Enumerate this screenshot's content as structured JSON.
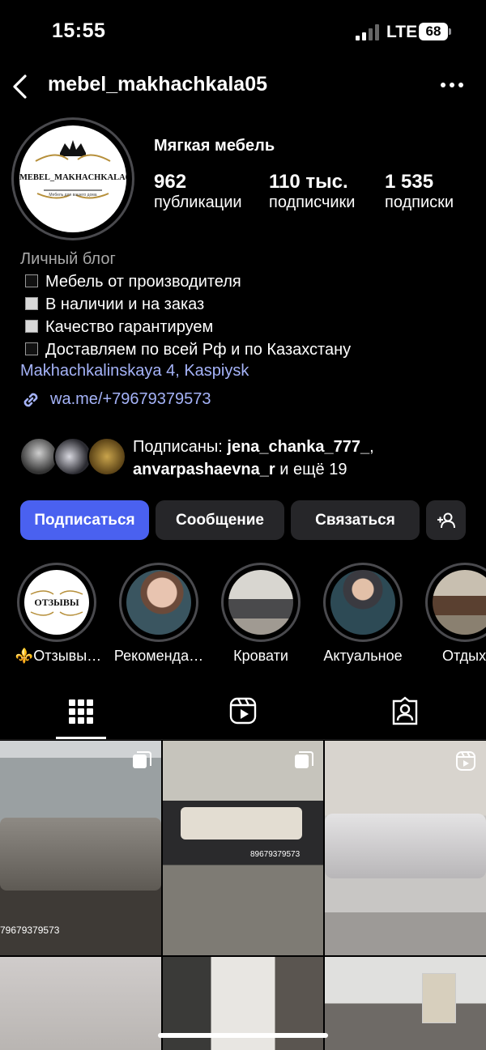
{
  "status_bar": {
    "time": "15:55",
    "network": "LTE",
    "battery": "68"
  },
  "header": {
    "username": "mebel_makhachkala05"
  },
  "profile": {
    "display_name": "Мягкая мебель",
    "avatar_text": "MEBEL_MAKHACHKALA05",
    "avatar_subtext": "Мебель для вашего дома",
    "stats": [
      {
        "value": "962",
        "label": "публикации"
      },
      {
        "value": "110 тыс.",
        "label": "подписчики"
      },
      {
        "value": "1 535",
        "label": "подписки"
      }
    ],
    "category": "Личный блог",
    "bio": [
      {
        "text": "Мебель от производителя",
        "marker": "dark"
      },
      {
        "text": "В наличии и на заказ",
        "marker": "light"
      },
      {
        "text": "Качество гарантируем",
        "marker": "light"
      },
      {
        "text": "Доставляем по всей Рф и по Казахстану",
        "marker": "dark"
      }
    ],
    "location": "Makhachkalinskaya 4, Kaspiysk",
    "link": "wa.me/+79679379573",
    "followed_by": {
      "prefix": "Подписаны: ",
      "user1": "jena_chanka_777_",
      "sep": ",",
      "user2": "anvarpashaevna_r",
      "suffix": " и ещё 19"
    }
  },
  "actions": {
    "follow": "Подписаться",
    "message": "Сообщение",
    "contact": "Связаться"
  },
  "highlights": [
    {
      "label": "⚜️Отзывы…",
      "cover_text": "ОТЗЫВЫ"
    },
    {
      "label": "Рекоменда…"
    },
    {
      "label": "Кровати"
    },
    {
      "label": "Актуальное"
    },
    {
      "label": "Отдых"
    }
  ],
  "tabs": [
    "grid",
    "reels",
    "tagged"
  ],
  "grid": [
    {
      "overlay_text": "79679379573",
      "badge": "carousel"
    },
    {
      "overlay_text": "89679379573",
      "badge": "carousel"
    },
    {
      "overlay_text": "",
      "badge": "reel"
    },
    {
      "overlay_text": "",
      "badge": ""
    },
    {
      "overlay_text": "",
      "badge": ""
    },
    {
      "overlay_text": "",
      "badge": ""
    }
  ],
  "colors": {
    "accent": "#4a61f0",
    "link": "#a5b3f8",
    "button": "#262629",
    "background": "#000000"
  }
}
